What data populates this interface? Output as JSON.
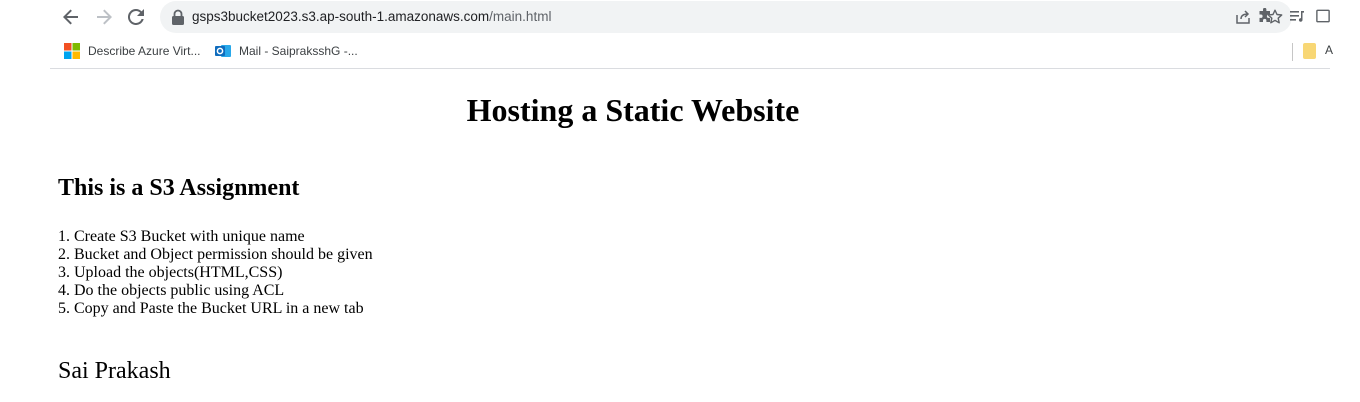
{
  "browser": {
    "url_host": "gsps3bucket2023.s3.ap-south-1.amazonaws.com",
    "url_path": "/main.html",
    "bookmarks": [
      {
        "label": "Describe Azure Virt...",
        "icon": "microsoft-icon"
      },
      {
        "label": "Mail - SaipraksshG -...",
        "icon": "outlook-icon"
      }
    ],
    "bookmark_folder_label": "A"
  },
  "page": {
    "title": "Hosting a Static Website",
    "subtitle": "This is a S3 Assignment",
    "steps": [
      "1. Create S3 Bucket with unique name",
      "2. Bucket and Object permission should be given",
      "3. Upload the objects(HTML,CSS)",
      "4. Do the objects public using ACL",
      "5. Copy and Paste the Bucket URL in a new tab"
    ],
    "author": "Sai Prakash"
  },
  "colors": {
    "omnibox_bg": "#f1f3f4",
    "icon_gray": "#5f6368",
    "folder_yellow": "#f8d775",
    "outlook_blue": "#0f6cbd"
  }
}
